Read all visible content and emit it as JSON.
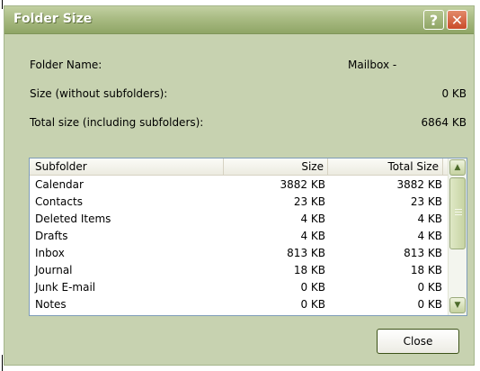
{
  "window": {
    "title": "Folder Size",
    "help_glyph": "?",
    "close_glyph": "✕"
  },
  "info": {
    "folder_name_label": "Folder Name:",
    "folder_name_value": "Mailbox -",
    "size_label": "Size (without subfolders):",
    "size_value": "0 KB",
    "total_label": "Total size (including subfolders):",
    "total_value": "6864 KB"
  },
  "table": {
    "headers": [
      "Subfolder",
      "Size",
      "Total Size"
    ],
    "rows": [
      {
        "name": "Calendar",
        "size": "3882 KB",
        "total": "3882 KB"
      },
      {
        "name": "Contacts",
        "size": "23 KB",
        "total": "23 KB"
      },
      {
        "name": "Deleted Items",
        "size": "4 KB",
        "total": "4 KB"
      },
      {
        "name": "Drafts",
        "size": "4 KB",
        "total": "4 KB"
      },
      {
        "name": "Inbox",
        "size": "813 KB",
        "total": "813 KB"
      },
      {
        "name": "Journal",
        "size": "18 KB",
        "total": "18 KB"
      },
      {
        "name": "Junk E-mail",
        "size": "0 KB",
        "total": "0 KB"
      },
      {
        "name": "Notes",
        "size": "0 KB",
        "total": "0 KB"
      }
    ]
  },
  "buttons": {
    "close_label": "Close"
  },
  "icons": {
    "help": "help-icon",
    "close": "close-icon",
    "scroll_up": "arrow-up-icon",
    "scroll_down": "arrow-down-icon"
  },
  "colors": {
    "titlebar": "#a9bb83",
    "dialog_bg": "#c7d2b0",
    "close_button_red": "#c94b2a"
  }
}
